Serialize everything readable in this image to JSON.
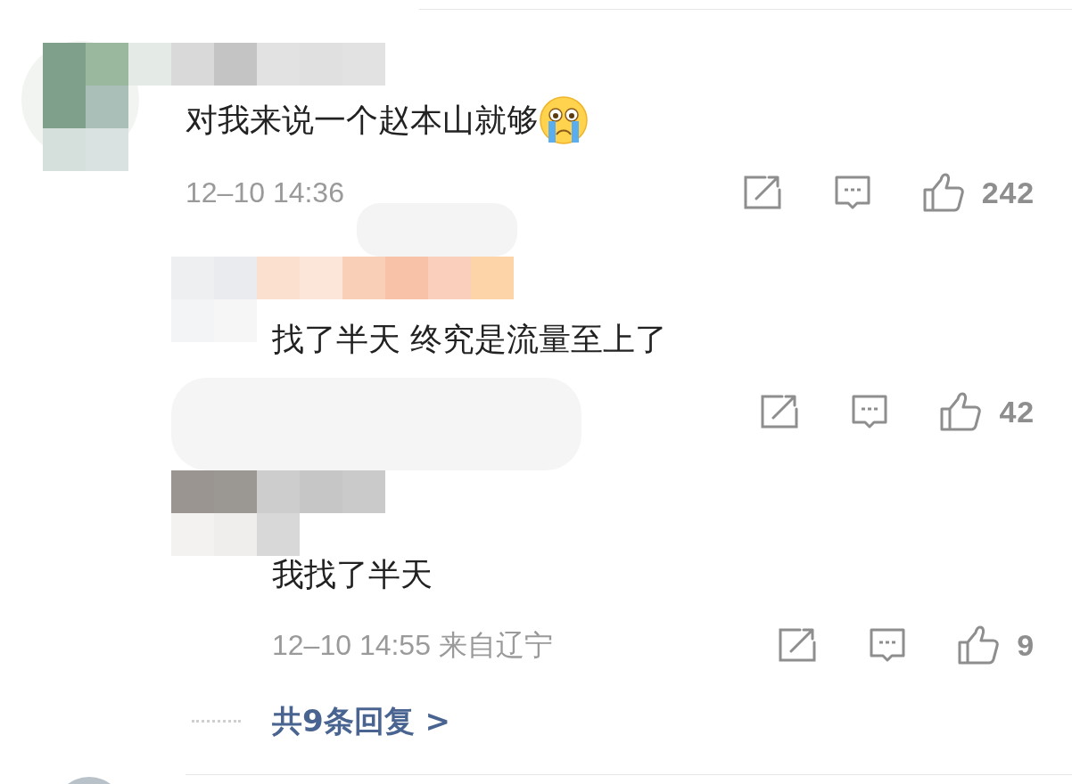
{
  "comment": {
    "text": "对我来说一个赵本山就够",
    "meta": "12–10 14:36",
    "like_count": "242"
  },
  "replies": [
    {
      "text": "找了半天 终究是流量至上了",
      "like_count": "42"
    },
    {
      "text": "我找了半天",
      "meta": "12–10 14:55 来自辽宁",
      "like_count": "9"
    }
  ],
  "more_replies": {
    "label": "共9条回复 >"
  }
}
